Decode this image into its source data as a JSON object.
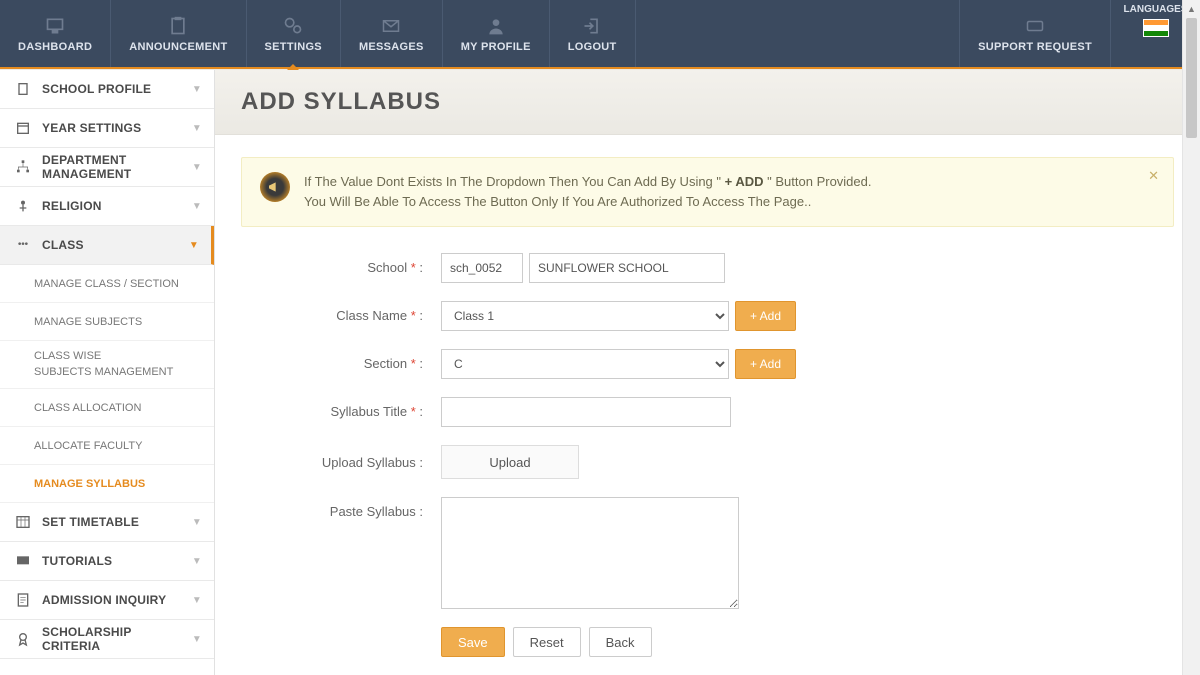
{
  "topnav": {
    "items": [
      "DASHBOARD",
      "ANNOUNCEMENT",
      "SETTINGS",
      "MESSAGES",
      "MY PROFILE",
      "LOGOUT"
    ],
    "support": "SUPPORT REQUEST",
    "languages_label": "LANGUAGES"
  },
  "sidebar": {
    "items": [
      "SCHOOL PROFILE",
      "YEAR SETTINGS",
      "DEPARTMENT MANAGEMENT",
      "RELIGION",
      "CLASS",
      "SET TIMETABLE",
      "TUTORIALS",
      "ADMISSION INQUIRY",
      "SCHOLARSHIP CRITERIA"
    ],
    "class_sub": [
      "MANAGE CLASS / SECTION",
      "MANAGE SUBJECTS",
      "CLASS WISE",
      "SUBJECTS MANAGEMENT",
      "CLASS ALLOCATION",
      "ALLOCATE FACULTY",
      "MANAGE SYLLABUS"
    ]
  },
  "page": {
    "title": "ADD SYLLABUS"
  },
  "alert": {
    "line1a": "If The Value Dont Exists In The Dropdown Then You Can Add By Using \" ",
    "bold": "+ ADD",
    "line1b": " \" Button Provided.",
    "line2": "You Will Be Able To Access The Button Only If You Are Authorized To Access The Page.."
  },
  "form": {
    "school_label": "School",
    "school_code": "sch_0052",
    "school_name": "SUNFLOWER SCHOOL",
    "class_label": "Class Name",
    "class_value": "Class 1",
    "section_label": "Section",
    "section_value": "C",
    "title_label": "Syllabus Title",
    "upload_label": "Upload Syllabus :",
    "paste_label": "Paste Syllabus :",
    "add_btn": "+ Add",
    "upload_btn": "Upload",
    "save": "Save",
    "reset": "Reset",
    "back": "Back"
  }
}
